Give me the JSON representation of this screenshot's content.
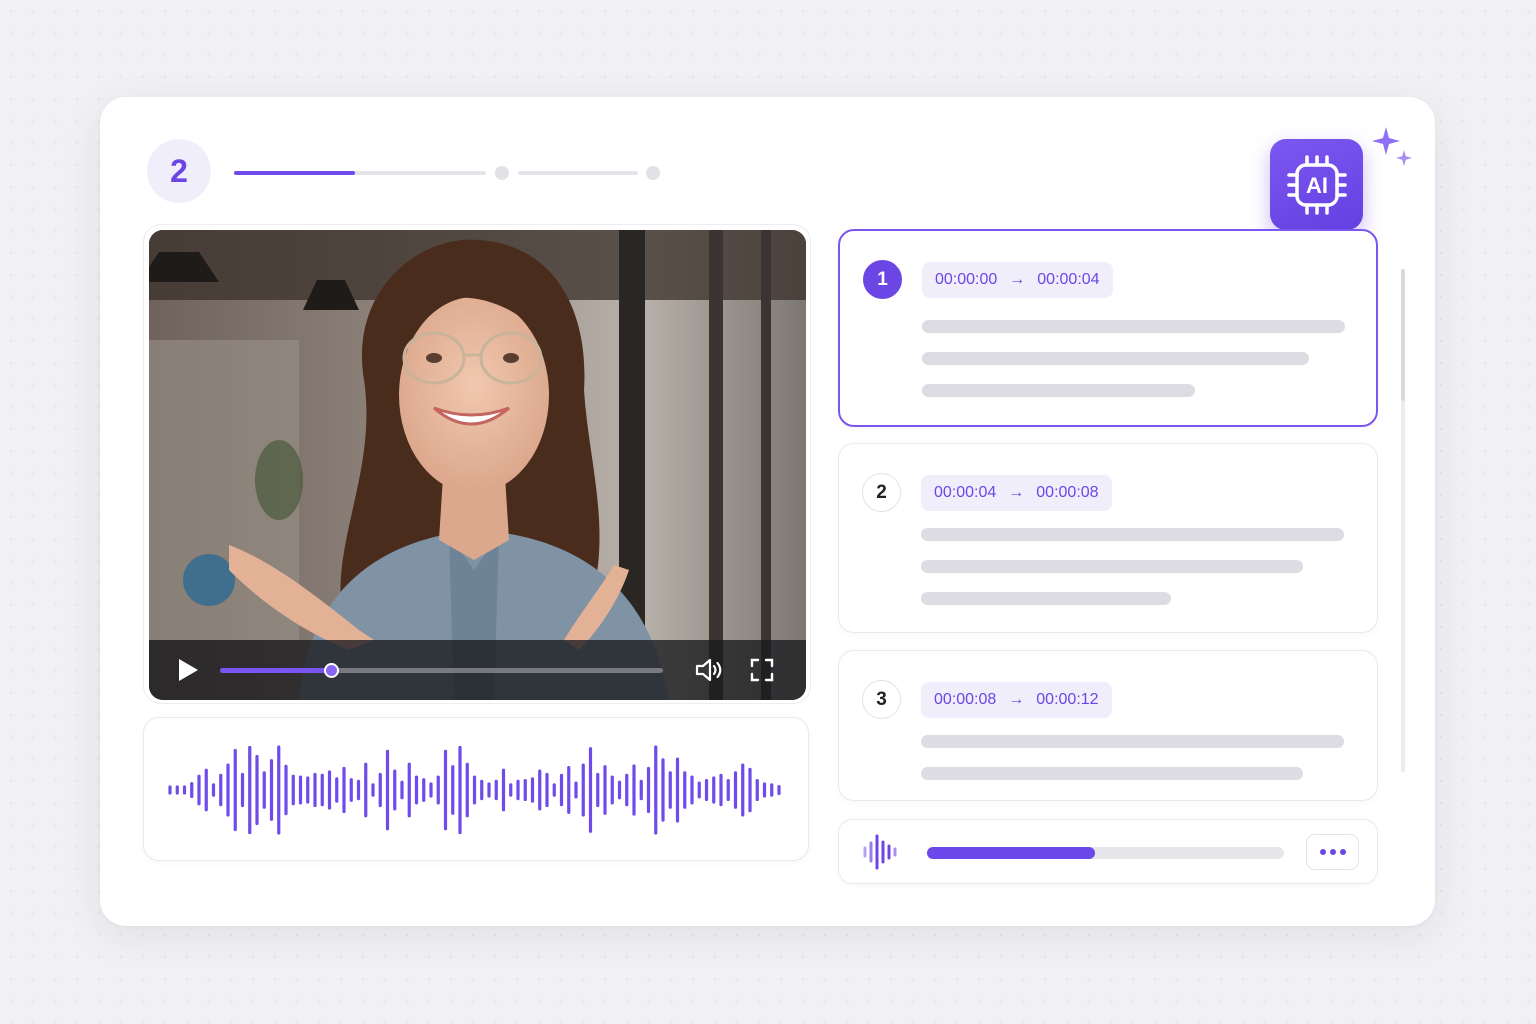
{
  "step": {
    "number": "2",
    "progress": 0.48,
    "total_segments": 3,
    "completed_segments": 1
  },
  "ai_badge": {
    "label": "AI",
    "icon": "ai-chip-icon"
  },
  "video": {
    "progress": 0.25,
    "icons": [
      "play-icon",
      "volume-icon",
      "fullscreen-icon"
    ]
  },
  "waveform": {
    "amplitudes": [
      0.05,
      0.05,
      0.06,
      0.15,
      0.32,
      0.46,
      0.12,
      0.34,
      0.58,
      0.92,
      0.36,
      0.99,
      0.78,
      0.4,
      0.68,
      1.0,
      0.55,
      0.32,
      0.3,
      0.28,
      0.36,
      0.34,
      0.42,
      0.26,
      0.5,
      0.24,
      0.2,
      0.6,
      0.12,
      0.36,
      0.9,
      0.44,
      0.18,
      0.6,
      0.3,
      0.24,
      0.14,
      0.3,
      0.9,
      0.54,
      0.99,
      0.6,
      0.3,
      0.2,
      0.14,
      0.2,
      0.46,
      0.12,
      0.2,
      0.22,
      0.26,
      0.44,
      0.36,
      0.12,
      0.34,
      0.52,
      0.16,
      0.58,
      0.96,
      0.36,
      0.54,
      0.3,
      0.18,
      0.34,
      0.56,
      0.2,
      0.5,
      1.0,
      0.7,
      0.4,
      0.72,
      0.4,
      0.3,
      0.16,
      0.22,
      0.28,
      0.34,
      0.22,
      0.4,
      0.58,
      0.48,
      0.22,
      0.14,
      0.12,
      0.08
    ],
    "color": "#6e4bea"
  },
  "segments": [
    {
      "number": "1",
      "start": "00:00:00",
      "arrow": "→",
      "end": "00:00:04",
      "active": true,
      "lines": [
        0.93,
        0.85,
        0.6
      ]
    },
    {
      "number": "2",
      "start": "00:00:04",
      "arrow": "→",
      "end": "00:00:08",
      "active": false,
      "lines": [
        0.93,
        0.84,
        0.55
      ]
    },
    {
      "number": "3",
      "start": "00:00:08",
      "arrow": "→",
      "end": "00:00:12",
      "active": false,
      "lines": [
        0.93,
        0.84
      ]
    }
  ],
  "audio": {
    "progress": 0.47,
    "more_icon": "more-dots-icon"
  },
  "colors": {
    "accent": "#6b46e5",
    "accent_light": "#f1eefc",
    "placeholder": "#dcdce2"
  }
}
